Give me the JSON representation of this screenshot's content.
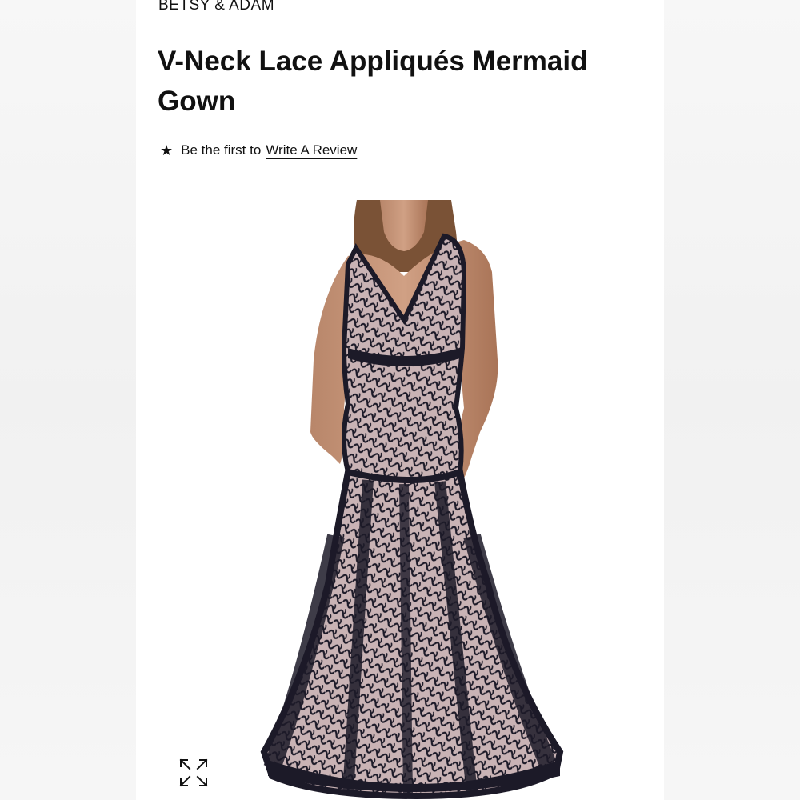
{
  "product": {
    "brand": "BETSY & ADAM",
    "title": "V-Neck Lace Appliqués Mermaid Gown",
    "review_prefix": "Be the first to",
    "review_link": "Write A Review",
    "star_icon": "star-icon",
    "expand_icon": "expand-icon"
  },
  "colors": {
    "text": "#111111",
    "page_bg": "#f4f4f4",
    "card_bg": "#ffffff",
    "gown": "#1c1a28",
    "lining": "#c9b3b5"
  }
}
